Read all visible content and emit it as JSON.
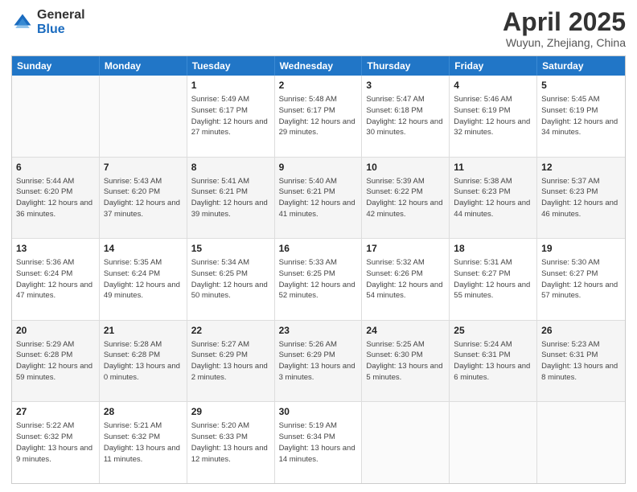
{
  "logo": {
    "general": "General",
    "blue": "Blue"
  },
  "title": {
    "month": "April 2025",
    "location": "Wuyun, Zhejiang, China"
  },
  "header_days": [
    "Sunday",
    "Monday",
    "Tuesday",
    "Wednesday",
    "Thursday",
    "Friday",
    "Saturday"
  ],
  "weeks": [
    [
      {
        "day": "",
        "info": ""
      },
      {
        "day": "",
        "info": ""
      },
      {
        "day": "1",
        "info": "Sunrise: 5:49 AM\nSunset: 6:17 PM\nDaylight: 12 hours and 27 minutes."
      },
      {
        "day": "2",
        "info": "Sunrise: 5:48 AM\nSunset: 6:17 PM\nDaylight: 12 hours and 29 minutes."
      },
      {
        "day": "3",
        "info": "Sunrise: 5:47 AM\nSunset: 6:18 PM\nDaylight: 12 hours and 30 minutes."
      },
      {
        "day": "4",
        "info": "Sunrise: 5:46 AM\nSunset: 6:19 PM\nDaylight: 12 hours and 32 minutes."
      },
      {
        "day": "5",
        "info": "Sunrise: 5:45 AM\nSunset: 6:19 PM\nDaylight: 12 hours and 34 minutes."
      }
    ],
    [
      {
        "day": "6",
        "info": "Sunrise: 5:44 AM\nSunset: 6:20 PM\nDaylight: 12 hours and 36 minutes."
      },
      {
        "day": "7",
        "info": "Sunrise: 5:43 AM\nSunset: 6:20 PM\nDaylight: 12 hours and 37 minutes."
      },
      {
        "day": "8",
        "info": "Sunrise: 5:41 AM\nSunset: 6:21 PM\nDaylight: 12 hours and 39 minutes."
      },
      {
        "day": "9",
        "info": "Sunrise: 5:40 AM\nSunset: 6:21 PM\nDaylight: 12 hours and 41 minutes."
      },
      {
        "day": "10",
        "info": "Sunrise: 5:39 AM\nSunset: 6:22 PM\nDaylight: 12 hours and 42 minutes."
      },
      {
        "day": "11",
        "info": "Sunrise: 5:38 AM\nSunset: 6:23 PM\nDaylight: 12 hours and 44 minutes."
      },
      {
        "day": "12",
        "info": "Sunrise: 5:37 AM\nSunset: 6:23 PM\nDaylight: 12 hours and 46 minutes."
      }
    ],
    [
      {
        "day": "13",
        "info": "Sunrise: 5:36 AM\nSunset: 6:24 PM\nDaylight: 12 hours and 47 minutes."
      },
      {
        "day": "14",
        "info": "Sunrise: 5:35 AM\nSunset: 6:24 PM\nDaylight: 12 hours and 49 minutes."
      },
      {
        "day": "15",
        "info": "Sunrise: 5:34 AM\nSunset: 6:25 PM\nDaylight: 12 hours and 50 minutes."
      },
      {
        "day": "16",
        "info": "Sunrise: 5:33 AM\nSunset: 6:25 PM\nDaylight: 12 hours and 52 minutes."
      },
      {
        "day": "17",
        "info": "Sunrise: 5:32 AM\nSunset: 6:26 PM\nDaylight: 12 hours and 54 minutes."
      },
      {
        "day": "18",
        "info": "Sunrise: 5:31 AM\nSunset: 6:27 PM\nDaylight: 12 hours and 55 minutes."
      },
      {
        "day": "19",
        "info": "Sunrise: 5:30 AM\nSunset: 6:27 PM\nDaylight: 12 hours and 57 minutes."
      }
    ],
    [
      {
        "day": "20",
        "info": "Sunrise: 5:29 AM\nSunset: 6:28 PM\nDaylight: 12 hours and 59 minutes."
      },
      {
        "day": "21",
        "info": "Sunrise: 5:28 AM\nSunset: 6:28 PM\nDaylight: 13 hours and 0 minutes."
      },
      {
        "day": "22",
        "info": "Sunrise: 5:27 AM\nSunset: 6:29 PM\nDaylight: 13 hours and 2 minutes."
      },
      {
        "day": "23",
        "info": "Sunrise: 5:26 AM\nSunset: 6:29 PM\nDaylight: 13 hours and 3 minutes."
      },
      {
        "day": "24",
        "info": "Sunrise: 5:25 AM\nSunset: 6:30 PM\nDaylight: 13 hours and 5 minutes."
      },
      {
        "day": "25",
        "info": "Sunrise: 5:24 AM\nSunset: 6:31 PM\nDaylight: 13 hours and 6 minutes."
      },
      {
        "day": "26",
        "info": "Sunrise: 5:23 AM\nSunset: 6:31 PM\nDaylight: 13 hours and 8 minutes."
      }
    ],
    [
      {
        "day": "27",
        "info": "Sunrise: 5:22 AM\nSunset: 6:32 PM\nDaylight: 13 hours and 9 minutes."
      },
      {
        "day": "28",
        "info": "Sunrise: 5:21 AM\nSunset: 6:32 PM\nDaylight: 13 hours and 11 minutes."
      },
      {
        "day": "29",
        "info": "Sunrise: 5:20 AM\nSunset: 6:33 PM\nDaylight: 13 hours and 12 minutes."
      },
      {
        "day": "30",
        "info": "Sunrise: 5:19 AM\nSunset: 6:34 PM\nDaylight: 13 hours and 14 minutes."
      },
      {
        "day": "",
        "info": ""
      },
      {
        "day": "",
        "info": ""
      },
      {
        "day": "",
        "info": ""
      }
    ]
  ]
}
